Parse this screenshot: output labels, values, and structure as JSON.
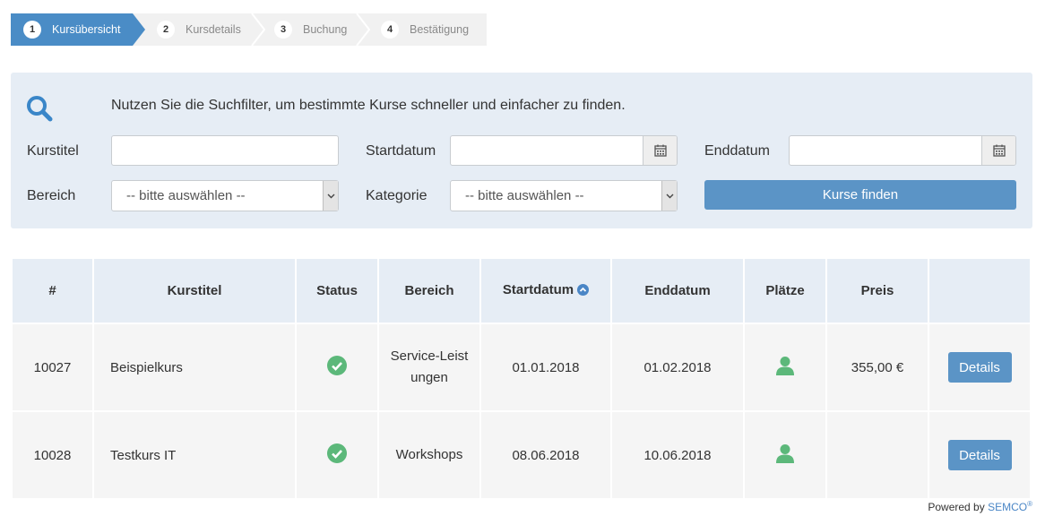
{
  "stepper": {
    "steps": [
      {
        "num": "1",
        "label": "Kursübersicht",
        "active": true
      },
      {
        "num": "2",
        "label": "Kursdetails",
        "active": false
      },
      {
        "num": "3",
        "label": "Buchung",
        "active": false
      },
      {
        "num": "4",
        "label": "Bestätigung",
        "active": false
      }
    ]
  },
  "filters": {
    "intro": "Nutzen Sie die Suchfilter, um bestimmte Kurse schneller und einfacher zu finden.",
    "kurstitel_label": "Kurstitel",
    "kurstitel_value": "",
    "startdatum_label": "Startdatum",
    "startdatum_value": "",
    "enddatum_label": "Enddatum",
    "enddatum_value": "",
    "bereich_label": "Bereich",
    "bereich_selected": "-- bitte auswählen --",
    "kategorie_label": "Kategorie",
    "kategorie_selected": "-- bitte auswählen --",
    "find_button": "Kurse finden"
  },
  "table": {
    "headers": [
      "#",
      "Kurstitel",
      "Status",
      "Bereich",
      "Startdatum",
      "Enddatum",
      "Plätze",
      "Preis",
      ""
    ],
    "sorted_column": "Startdatum",
    "sort_direction": "ascending",
    "rows": [
      {
        "id": "10027",
        "title": "Beispielkurs",
        "status": "ok",
        "bereich": "Service-Leistungen",
        "start": "01.01.2018",
        "end": "01.02.2018",
        "plaetze": "available",
        "preis": "355,00 €",
        "action": "Details"
      },
      {
        "id": "10028",
        "title": "Testkurs IT",
        "status": "ok",
        "bereich": "Workshops",
        "start": "08.06.2018",
        "end": "10.06.2018",
        "plaetze": "available",
        "preis": "",
        "action": "Details"
      }
    ]
  },
  "footer": {
    "powered_by": "Powered by",
    "brand": "SEMCO",
    "registered": "®"
  },
  "colors": {
    "accent": "#5b94c6",
    "panel_bg": "#e6edf5",
    "success_green": "#5cb87a",
    "row_bg": "#f5f5f5"
  },
  "icons": {
    "search": "search-icon",
    "calendar": "calendar-icon",
    "status": "check-circle-icon",
    "places": "user-icon",
    "sort": "chevron-up-circle-icon"
  }
}
